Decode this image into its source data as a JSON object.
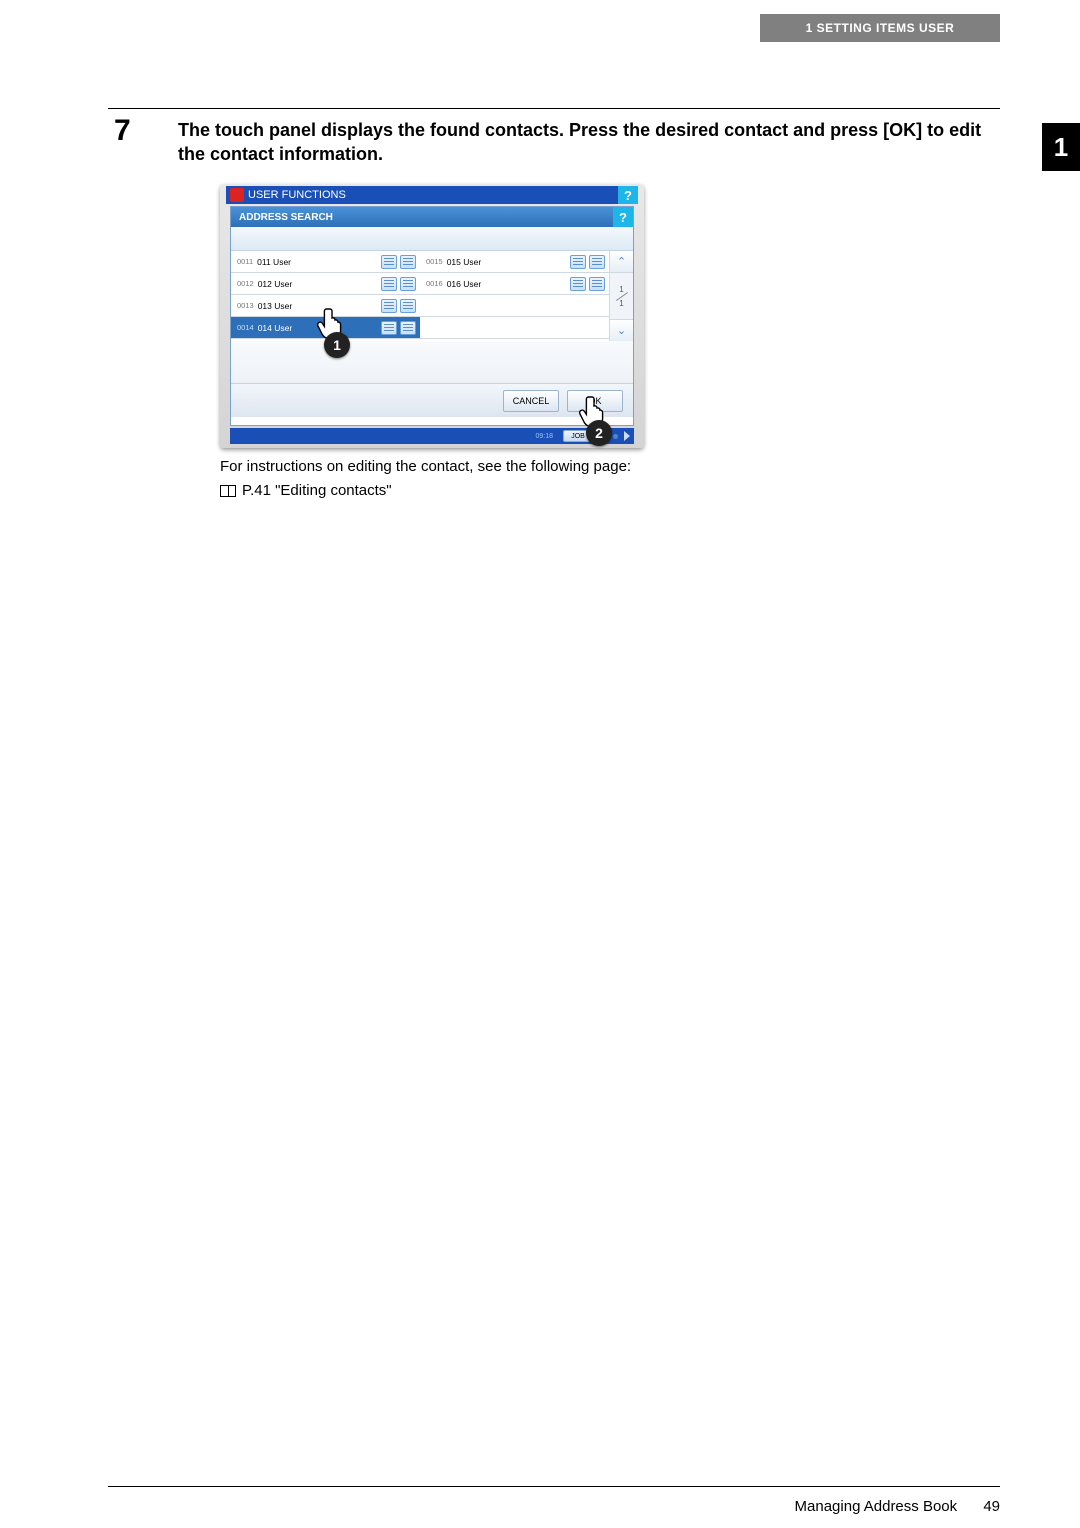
{
  "header": {
    "breadcrumb": "1 SETTING ITEMS USER"
  },
  "side_tab": "1",
  "step": {
    "number": "7",
    "text": "The touch panel displays the found contacts. Press the desired contact and press [OK] to edit the contact information."
  },
  "panel": {
    "window_title": "USER FUNCTIONS",
    "dialog_title": "ADDRESS SEARCH",
    "help_glyph": "?",
    "contacts_left": [
      {
        "id": "0011",
        "name": "011 User",
        "selected": false
      },
      {
        "id": "0012",
        "name": "012 User",
        "selected": false
      },
      {
        "id": "0013",
        "name": "013 User",
        "selected": false
      },
      {
        "id": "0014",
        "name": "014 User",
        "selected": true
      }
    ],
    "contacts_right": [
      {
        "id": "0015",
        "name": "015 User"
      },
      {
        "id": "0016",
        "name": "016 User"
      }
    ],
    "page_indicator": {
      "current": "1",
      "total": "1"
    },
    "buttons": {
      "cancel": "CANCEL",
      "ok": "OK"
    },
    "status": {
      "time": "09:18",
      "job": "JOB"
    },
    "scroll": {
      "up": "⌃",
      "down": "⌄"
    }
  },
  "callouts": {
    "one": "1",
    "two": "2"
  },
  "body": {
    "line1": "For instructions on editing the contact, see the following page:",
    "ref": "P.41 \"Editing contacts\""
  },
  "footer": {
    "title": "Managing Address Book",
    "page": "49"
  }
}
